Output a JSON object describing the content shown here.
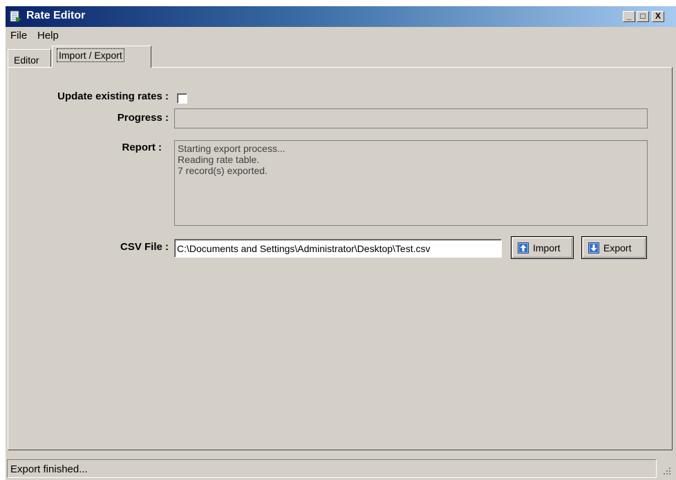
{
  "window": {
    "title": "Rate Editor",
    "controls": {
      "minimize": "_",
      "maximize": "□",
      "close": "X"
    }
  },
  "menu": [
    "File",
    "Help"
  ],
  "tabs": {
    "editor": "Editor",
    "import_export": "Import / Export",
    "active": "import_export"
  },
  "form": {
    "update_label": "Update existing rates :",
    "update_checked": false,
    "progress_label": "Progress :",
    "progress_value": 0,
    "report_label": "Report :",
    "report_lines": [
      "Starting export process...",
      "Reading rate table.",
      "7 record(s) exported."
    ],
    "csv_label": "CSV File :",
    "csv_value": "C:\\Documents and Settings\\Administrator\\Desktop\\Test.csv",
    "import_label": "Import",
    "export_label": "Export"
  },
  "icons": {
    "app": "spreadsheet-document-icon",
    "import": "arrow-up-icon",
    "export": "arrow-down-icon",
    "grip": "resize-grip-icon"
  },
  "status": {
    "text": "Export finished..."
  },
  "colors": {
    "titlebar_start": "#0a246a",
    "titlebar_end": "#a6caf0",
    "face": "#d4d0c8",
    "icon_blue": "#2f6fd0"
  }
}
